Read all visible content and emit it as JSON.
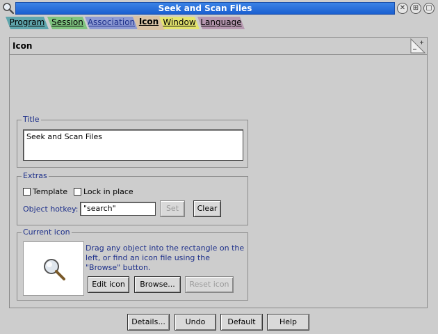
{
  "window": {
    "title": "Seek and Scan Files",
    "menu_icon": "search-magnifier-icon",
    "buttons": {
      "close": "close-icon",
      "iconify": "iconify-icon",
      "options": "options-icon"
    }
  },
  "tabs": [
    {
      "label": "Program",
      "color": "#5fa6ad"
    },
    {
      "label": "Session",
      "color": "#7fc47f"
    },
    {
      "label": "Association",
      "color": "#8d9ad3"
    },
    {
      "label": "Icon",
      "color": "#d9c2a5"
    },
    {
      "label": "Window",
      "color": "#e4e46e"
    },
    {
      "label": "Language",
      "color": "#b698b0"
    }
  ],
  "active_tab": "Icon",
  "panel": {
    "heading": "Icon",
    "title_group": {
      "label": "Title",
      "value": "Seek and Scan Files"
    },
    "extras_group": {
      "label": "Extras",
      "template_label": "Template",
      "lock_label": "Lock in place",
      "hotkey_label": "Object hotkey:",
      "hotkey_value": "\"search\"",
      "set_label": "Set",
      "clear_label": "Clear"
    },
    "current_icon_group": {
      "label": "Current icon",
      "description": "Drag any object into the rectangle on the left, or find an icon file using the \"Browse\" button.",
      "edit_label": "Edit icon",
      "browse_label": "Browse...",
      "reset_label": "Reset icon"
    }
  },
  "bottom_buttons": {
    "details": "Details...",
    "undo": "Undo",
    "default": "Default",
    "help": "Help"
  }
}
